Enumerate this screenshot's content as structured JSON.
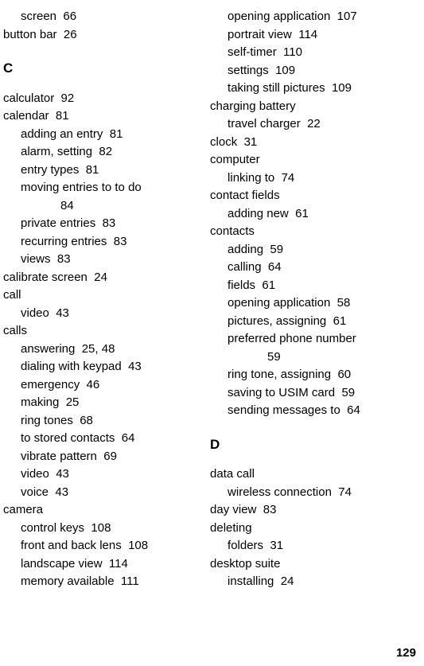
{
  "page_number": "129",
  "columns": [
    {
      "items": [
        {
          "type": "entry",
          "level": 1,
          "text": "screen",
          "page": "66"
        },
        {
          "type": "entry",
          "level": 0,
          "text": "button bar",
          "page": "26"
        },
        {
          "type": "head",
          "text": "C"
        },
        {
          "type": "entry",
          "level": 0,
          "text": "calculator",
          "page": "92"
        },
        {
          "type": "entry",
          "level": 0,
          "text": "calendar",
          "page": "81"
        },
        {
          "type": "entry",
          "level": 1,
          "text": "adding an entry",
          "page": "81"
        },
        {
          "type": "entry",
          "level": 1,
          "text": "alarm, setting",
          "page": "82"
        },
        {
          "type": "entry",
          "level": 1,
          "text": "entry types",
          "page": "81"
        },
        {
          "type": "entry",
          "level": 1,
          "text": "moving entries to to do",
          "page": ""
        },
        {
          "type": "cont",
          "level": 2,
          "text": "84"
        },
        {
          "type": "entry",
          "level": 1,
          "text": "private entries",
          "page": "83"
        },
        {
          "type": "entry",
          "level": 1,
          "text": "recurring entries",
          "page": "83"
        },
        {
          "type": "entry",
          "level": 1,
          "text": "views",
          "page": "83"
        },
        {
          "type": "entry",
          "level": 0,
          "text": "calibrate screen",
          "page": "24"
        },
        {
          "type": "entry",
          "level": 0,
          "text": "call",
          "page": ""
        },
        {
          "type": "entry",
          "level": 1,
          "text": "video",
          "page": "43"
        },
        {
          "type": "entry",
          "level": 0,
          "text": "calls",
          "page": ""
        },
        {
          "type": "entry",
          "level": 1,
          "text": "answering",
          "page": "25, 48"
        },
        {
          "type": "entry",
          "level": 1,
          "text": "dialing with keypad",
          "page": "43"
        },
        {
          "type": "entry",
          "level": 1,
          "text": "emergency",
          "page": "46"
        },
        {
          "type": "entry",
          "level": 1,
          "text": "making",
          "page": "25"
        },
        {
          "type": "entry",
          "level": 1,
          "text": "ring tones",
          "page": "68"
        },
        {
          "type": "entry",
          "level": 1,
          "text": "to stored contacts",
          "page": "64"
        },
        {
          "type": "entry",
          "level": 1,
          "text": "vibrate pattern",
          "page": "69"
        },
        {
          "type": "entry",
          "level": 1,
          "text": "video",
          "page": "43"
        },
        {
          "type": "entry",
          "level": 1,
          "text": "voice",
          "page": "43"
        },
        {
          "type": "entry",
          "level": 0,
          "text": "camera",
          "page": ""
        },
        {
          "type": "entry",
          "level": 1,
          "text": "control keys",
          "page": "108"
        },
        {
          "type": "entry",
          "level": 1,
          "text": "front and back lens",
          "page": "108"
        },
        {
          "type": "entry",
          "level": 1,
          "text": "landscape view",
          "page": "114"
        },
        {
          "type": "entry",
          "level": 1,
          "text": "memory available",
          "page": "111"
        }
      ]
    },
    {
      "items": [
        {
          "type": "entry",
          "level": 1,
          "text": "opening application",
          "page": "107"
        },
        {
          "type": "entry",
          "level": 1,
          "text": "portrait view",
          "page": "114"
        },
        {
          "type": "entry",
          "level": 1,
          "text": "self-timer",
          "page": "110"
        },
        {
          "type": "entry",
          "level": 1,
          "text": "settings",
          "page": "109"
        },
        {
          "type": "entry",
          "level": 1,
          "text": "taking still pictures",
          "page": "109"
        },
        {
          "type": "entry",
          "level": 0,
          "text": "charging battery",
          "page": ""
        },
        {
          "type": "entry",
          "level": 1,
          "text": "travel charger",
          "page": "22"
        },
        {
          "type": "entry",
          "level": 0,
          "text": "clock",
          "page": "31"
        },
        {
          "type": "entry",
          "level": 0,
          "text": "computer",
          "page": ""
        },
        {
          "type": "entry",
          "level": 1,
          "text": "linking to",
          "page": "74"
        },
        {
          "type": "entry",
          "level": 0,
          "text": "contact fields",
          "page": ""
        },
        {
          "type": "entry",
          "level": 1,
          "text": "adding new",
          "page": "61"
        },
        {
          "type": "entry",
          "level": 0,
          "text": "contacts",
          "page": ""
        },
        {
          "type": "entry",
          "level": 1,
          "text": "adding",
          "page": "59"
        },
        {
          "type": "entry",
          "level": 1,
          "text": "calling",
          "page": "64"
        },
        {
          "type": "entry",
          "level": 1,
          "text": "fields",
          "page": "61"
        },
        {
          "type": "entry",
          "level": 1,
          "text": "opening application",
          "page": "58"
        },
        {
          "type": "entry",
          "level": 1,
          "text": "pictures, assigning",
          "page": "61"
        },
        {
          "type": "entry",
          "level": 1,
          "text": "preferred phone number",
          "page": ""
        },
        {
          "type": "cont",
          "level": 2,
          "text": "59"
        },
        {
          "type": "entry",
          "level": 1,
          "text": "ring tone, assigning",
          "page": "60"
        },
        {
          "type": "entry",
          "level": 1,
          "text": "saving to USIM card",
          "page": "59"
        },
        {
          "type": "entry",
          "level": 1,
          "text": "sending messages to",
          "page": "64"
        },
        {
          "type": "head",
          "text": "D"
        },
        {
          "type": "entry",
          "level": 0,
          "text": "data call",
          "page": ""
        },
        {
          "type": "entry",
          "level": 1,
          "text": "wireless connection",
          "page": "74"
        },
        {
          "type": "entry",
          "level": 0,
          "text": "day view",
          "page": "83"
        },
        {
          "type": "entry",
          "level": 0,
          "text": "deleting",
          "page": ""
        },
        {
          "type": "entry",
          "level": 1,
          "text": "folders",
          "page": "31"
        },
        {
          "type": "entry",
          "level": 0,
          "text": "desktop suite",
          "page": ""
        },
        {
          "type": "entry",
          "level": 1,
          "text": "installing",
          "page": "24"
        }
      ]
    }
  ]
}
